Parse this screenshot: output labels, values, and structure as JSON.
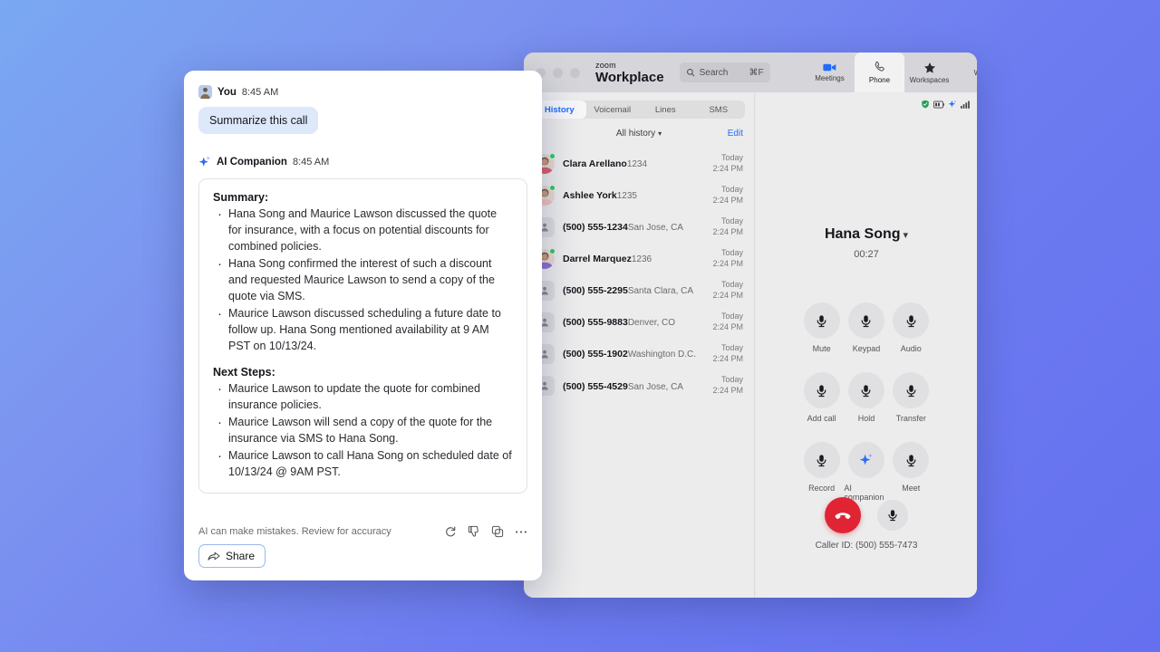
{
  "background": {
    "from": "#7aa8f2",
    "to": "#6470ef"
  },
  "zoom_window": {
    "brand_line1": "zoom",
    "brand_line2": "Workplace",
    "search": {
      "placeholder": "Search",
      "shortcut": "⌘F"
    },
    "nav_tabs": [
      {
        "label": "Meetings",
        "icon": "video-camera-icon",
        "active": false
      },
      {
        "label": "Phone",
        "icon": "phone-handset-icon",
        "active": true
      },
      {
        "label": "Workspaces",
        "icon": "star-icon",
        "active": false
      },
      {
        "label": "Wo",
        "icon": "clipped-icon",
        "active": false
      }
    ],
    "left_pane": {
      "sub_tabs": [
        {
          "label": "History",
          "active": true
        },
        {
          "label": "Voicemail",
          "active": false
        },
        {
          "label": "Lines",
          "active": false
        },
        {
          "label": "SMS",
          "active": false
        }
      ],
      "filter_label": "All history",
      "edit_label": "Edit",
      "calls": [
        {
          "name": "Clara Arellano",
          "sub": "1234",
          "day": "Today",
          "time": "2:24 PM",
          "avatar": "photo",
          "avatar_color": "#d9606a",
          "presence": "available"
        },
        {
          "name": "Ashlee York",
          "sub": "1235",
          "day": "Today",
          "time": "2:24 PM",
          "avatar": "photo",
          "avatar_color": "#f0c0bd",
          "presence": "available"
        },
        {
          "name": "(500) 555-1234",
          "sub": "San Jose, CA",
          "day": "Today",
          "time": "2:24 PM",
          "avatar": "generic",
          "presence": "none"
        },
        {
          "name": "Darrel Marquez",
          "sub": "1236",
          "day": "Today",
          "time": "2:24 PM",
          "avatar": "photo",
          "avatar_color": "#8b6fd4",
          "presence": "available"
        },
        {
          "name": "(500) 555-2295",
          "sub": "Santa Clara, CA",
          "day": "Today",
          "time": "2:24 PM",
          "avatar": "generic",
          "presence": "none"
        },
        {
          "name": "(500) 555-9883",
          "sub": "Denver, CO",
          "day": "Today",
          "time": "2:24 PM",
          "avatar": "generic",
          "presence": "none"
        },
        {
          "name": "(500) 555-1902",
          "sub": "Washington D.C.",
          "day": "Today",
          "time": "2:24 PM",
          "avatar": "generic",
          "presence": "none"
        },
        {
          "name": "(500) 555-4529",
          "sub": "San Jose, CA",
          "day": "Today",
          "time": "2:24 PM",
          "avatar": "generic",
          "presence": "none"
        }
      ]
    },
    "call_pane": {
      "status_icons": [
        "shield-icon",
        "battery-icon",
        "ai-sparkle-icon",
        "signal-bars-icon"
      ],
      "caller_name": "Hana Song",
      "timer": "00:27",
      "controls": [
        {
          "label": "Mute",
          "icon": "microphone-icon"
        },
        {
          "label": "Keypad",
          "icon": "microphone-icon"
        },
        {
          "label": "Audio",
          "icon": "microphone-icon"
        },
        {
          "label": "Add call",
          "icon": "microphone-icon"
        },
        {
          "label": "Hold",
          "icon": "microphone-icon"
        },
        {
          "label": "Transfer",
          "icon": "microphone-icon"
        },
        {
          "label": "Record",
          "icon": "microphone-icon"
        },
        {
          "label": "AI companion",
          "icon": "ai-sparkle-icon"
        },
        {
          "label": "Meet",
          "icon": "microphone-icon"
        }
      ],
      "end_call_icon": "end-call-icon",
      "end_call_color": "#e02433",
      "secondary_icon": "microphone-icon",
      "caller_id": "Caller ID: (500) 555-7473"
    }
  },
  "chat_panel": {
    "user_message": {
      "author": "You",
      "time": "8:45 AM",
      "text": "Summarize this call"
    },
    "ai_message": {
      "author": "AI Companion",
      "time": "8:45 AM",
      "summary_heading": "Summary:",
      "summary_items": [
        "Hana Song and Maurice Lawson discussed the quote for insurance, with a focus on potential discounts for combined policies.",
        "Hana Song confirmed the interest of such a discount and requested Maurice Lawson to send a copy of the quote via SMS.",
        "Maurice Lawson discussed scheduling a future date to follow up. Hana Song mentioned availability at 9 AM PST on 10/13/24."
      ],
      "next_steps_heading": "Next Steps:",
      "next_steps_items": [
        "Maurice Lawson to update the quote for combined insurance policies.",
        "Maurice Lawson will send a copy of the quote for the insurance via SMS to Hana Song.",
        "Maurice Lawson to call Hana Song on scheduled date of 10/13/24 @ 9AM PST."
      ]
    },
    "disclaimer": "AI can make mistakes. Review for accuracy",
    "feedback_icons": [
      "regenerate-icon",
      "thumbs-down-icon",
      "copy-icon",
      "more-options-icon"
    ],
    "share_label": "Share"
  }
}
